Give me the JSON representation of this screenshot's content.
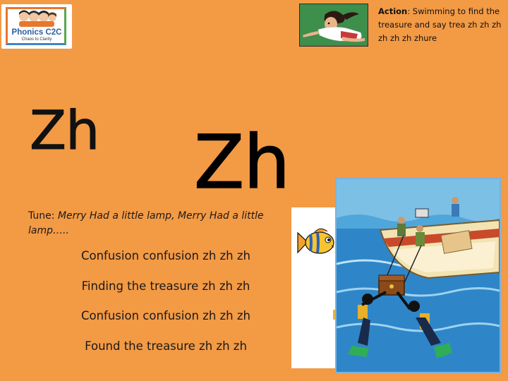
{
  "logo": {
    "title": "Phonics C2C",
    "subtitle": "Chaos to Clarity"
  },
  "action": {
    "label": "Action",
    "text": ": Swimming to find the treasure and say trea zh zh zh zh zh zh zhure"
  },
  "heading_small": "Zh",
  "heading_big": "Zh",
  "tune": {
    "label": "Tune: ",
    "song": "Merry Had a little lamp, Merry Had a little lamp….."
  },
  "verses": [
    "Confusion confusion zh zh zh",
    "Finding the treasure zh zh zh",
    "Confusion confusion zh zh zh",
    "Found the treasure zh zh zh"
  ],
  "colors": {
    "background": "#F39A45",
    "logo_blue": "#2E5E9E",
    "action_bg": "#3E8E4C",
    "sea": "#2E86C8"
  },
  "icons": {
    "logo": "children-logo-icon",
    "action": "swimming-girl-icon",
    "fish": "fish-icon",
    "scene": "divers-treasure-boat-illustration"
  }
}
